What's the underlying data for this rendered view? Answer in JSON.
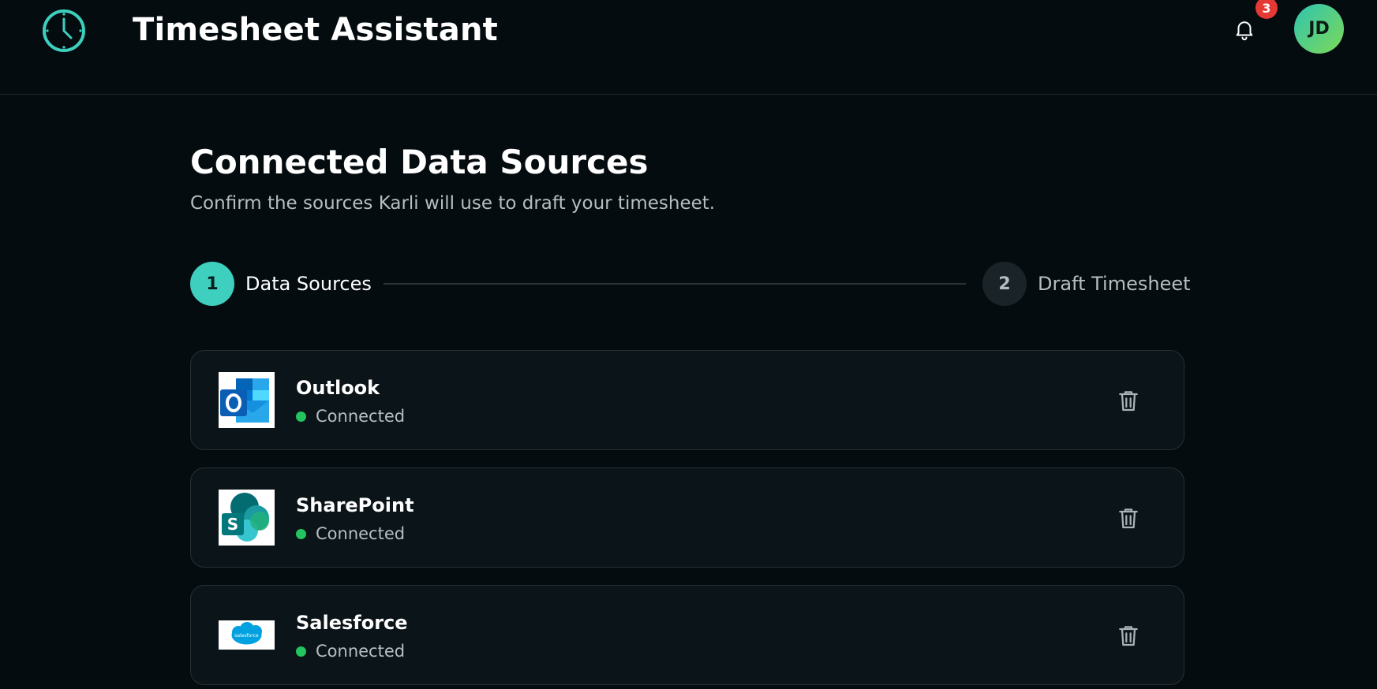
{
  "header": {
    "app_title": "Timesheet Assistant",
    "notification_count": "3",
    "avatar_initials": "JD"
  },
  "main": {
    "title": "Connected Data Sources",
    "subtitle": "Confirm the sources Karli will use to draft your timesheet."
  },
  "stepper": {
    "steps": [
      {
        "number": "1",
        "label": "Data Sources",
        "state": "active"
      },
      {
        "number": "2",
        "label": "Draft Timesheet",
        "state": "inactive"
      }
    ]
  },
  "sources": [
    {
      "name": "Outlook",
      "status": "Connected",
      "icon": "outlook-logo-icon"
    },
    {
      "name": "SharePoint",
      "status": "Connected",
      "icon": "sharepoint-logo-icon"
    },
    {
      "name": "Salesforce",
      "status": "Connected",
      "icon": "salesforce-logo-icon",
      "logo_text": "salesforce"
    }
  ],
  "colors": {
    "accent": "#3ecfbf",
    "status_connected": "#22c55e",
    "badge": "#e53935",
    "background": "#050c10"
  }
}
